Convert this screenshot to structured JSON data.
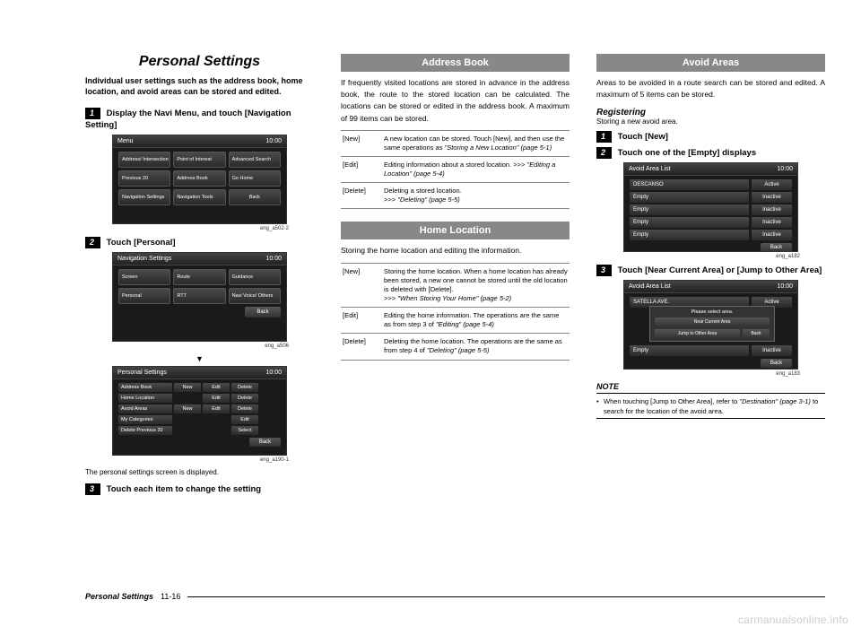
{
  "page": {
    "title": "Personal Settings",
    "footer_title": "Personal Settings",
    "footer_num": "11-16",
    "watermark": "carmanualsonline.info"
  },
  "col1": {
    "intro": "Individual user settings such as the address book, home location, and avoid areas can be stored and edited.",
    "step1": "Display the Navi Menu, and touch [Navigation Setting]",
    "sc1": {
      "header_left": "Menu",
      "header_right": "10:00",
      "buttons": [
        "Address/ Intersection",
        "Point of Interest",
        "Advanced Search",
        "Previous 20",
        "Address Book",
        "Go Home",
        "Navigation Settings",
        "Navigation Tools"
      ],
      "back": "Back",
      "caption": "eng_a502-2"
    },
    "step2": "Touch [Personal]",
    "sc2": {
      "header_left": "Navigation Settings",
      "header_right": "10:00",
      "buttons": [
        "Screen",
        "Route",
        "Guidance",
        "Personal",
        "RTT",
        "Navi Voice/ Others"
      ],
      "back": "Back",
      "caption": "eng_a506"
    },
    "sc3": {
      "header_left": "Personal Settings",
      "header_right": "10:00",
      "rows": [
        [
          "Address Book",
          "New",
          "Edit",
          "Delete"
        ],
        [
          "Home Location",
          "",
          "Edit",
          "Delete"
        ],
        [
          "Avoid Areas",
          "New",
          "Edit",
          "Delete"
        ],
        [
          "My Categories",
          "",
          "",
          "Edit"
        ],
        [
          "Delete Previous 20",
          "",
          "",
          "Select"
        ]
      ],
      "back": "Back",
      "caption": "eng_a190-1"
    },
    "after_sc3": "The personal settings screen is displayed.",
    "step3": "Touch each item to change the setting"
  },
  "col2": {
    "addr_title": "Address Book",
    "addr_desc": "If frequently visited locations are stored in advance in the address book, the route to the stored location can be calculated. The locations can be stored or edited in the address book. A maximum of 99 items can be stored.",
    "addr_table": [
      {
        "k": "[New]",
        "v": "A new location can be stored. Touch [New], and then use the same operations as ",
        "i": "\"Storing a New Location\" (page 5-1)"
      },
      {
        "k": "[Edit]",
        "v": "Editing information about a stored location. ",
        "p": ">>> ",
        "i": "\"Editing a Location\" (page 5-4)"
      },
      {
        "k": "[Delete]",
        "v": "Deleting a stored location.",
        "p": ">>> ",
        "i": "\"Deleting\" (page 5-5)"
      }
    ],
    "home_title": "Home Location",
    "home_desc": "Storing the home location and editing the information.",
    "home_table": [
      {
        "k": "[New]",
        "v": "Storing the home location. When a home location has already been stored, a new one cannot be stored until the old location is deleted with [Delete].",
        "p": ">>> ",
        "i": "\"When Storing Your Home\" (page 5-2)"
      },
      {
        "k": "[Edit]",
        "v": "Editing the home information. The operations are the same as from step 3 of ",
        "i": "\"Editing\" (page 5-4)"
      },
      {
        "k": "[Delete]",
        "v": "Deleting the home location. The operations are the same as from step 4 of ",
        "i": "\"Deleting\" (page 5-5)"
      }
    ]
  },
  "col3": {
    "avoid_title": "Avoid Areas",
    "avoid_desc": "Areas to be avoided in a route search can be stored and edited. A maximum of 5 items can be stored.",
    "reg_head": "Registering",
    "reg_sub": "Storing a new avoid area.",
    "step1": "Touch [New]",
    "step2": "Touch one of the [Empty] displays",
    "sc1": {
      "header_left": "Avoid Area List",
      "header_right": "10:00",
      "rows": [
        [
          "DESCANSO",
          "Active"
        ],
        [
          "Empty",
          "Inactive"
        ],
        [
          "Empty",
          "Inactive"
        ],
        [
          "Empty",
          "Inactive"
        ],
        [
          "Empty",
          "Inactive"
        ]
      ],
      "back": "Back",
      "caption": "eng_a182"
    },
    "step3": "Touch [Near Current Area] or [Jump to Other Area]",
    "sc2": {
      "header_left": "Avoid Area List",
      "header_right": "10:00",
      "dialog_title": "Please select area.",
      "dialog_btns": [
        "Near Current Area",
        "",
        ""
      ],
      "dialog_row2": [
        "Jump to Other Area",
        "Back"
      ],
      "row_top": [
        "SATELLA AVE.",
        "Active"
      ],
      "row_bottom": [
        "Empty",
        "Inactive"
      ],
      "back": "Back",
      "caption": "eng_a183"
    },
    "note_label": "NOTE",
    "note_body_1": "When touching [Jump to Other Area], refer to ",
    "note_body_i": "\"Destination\" (page 3-1)",
    "note_body_2": " to search for the location of the avoid area."
  }
}
